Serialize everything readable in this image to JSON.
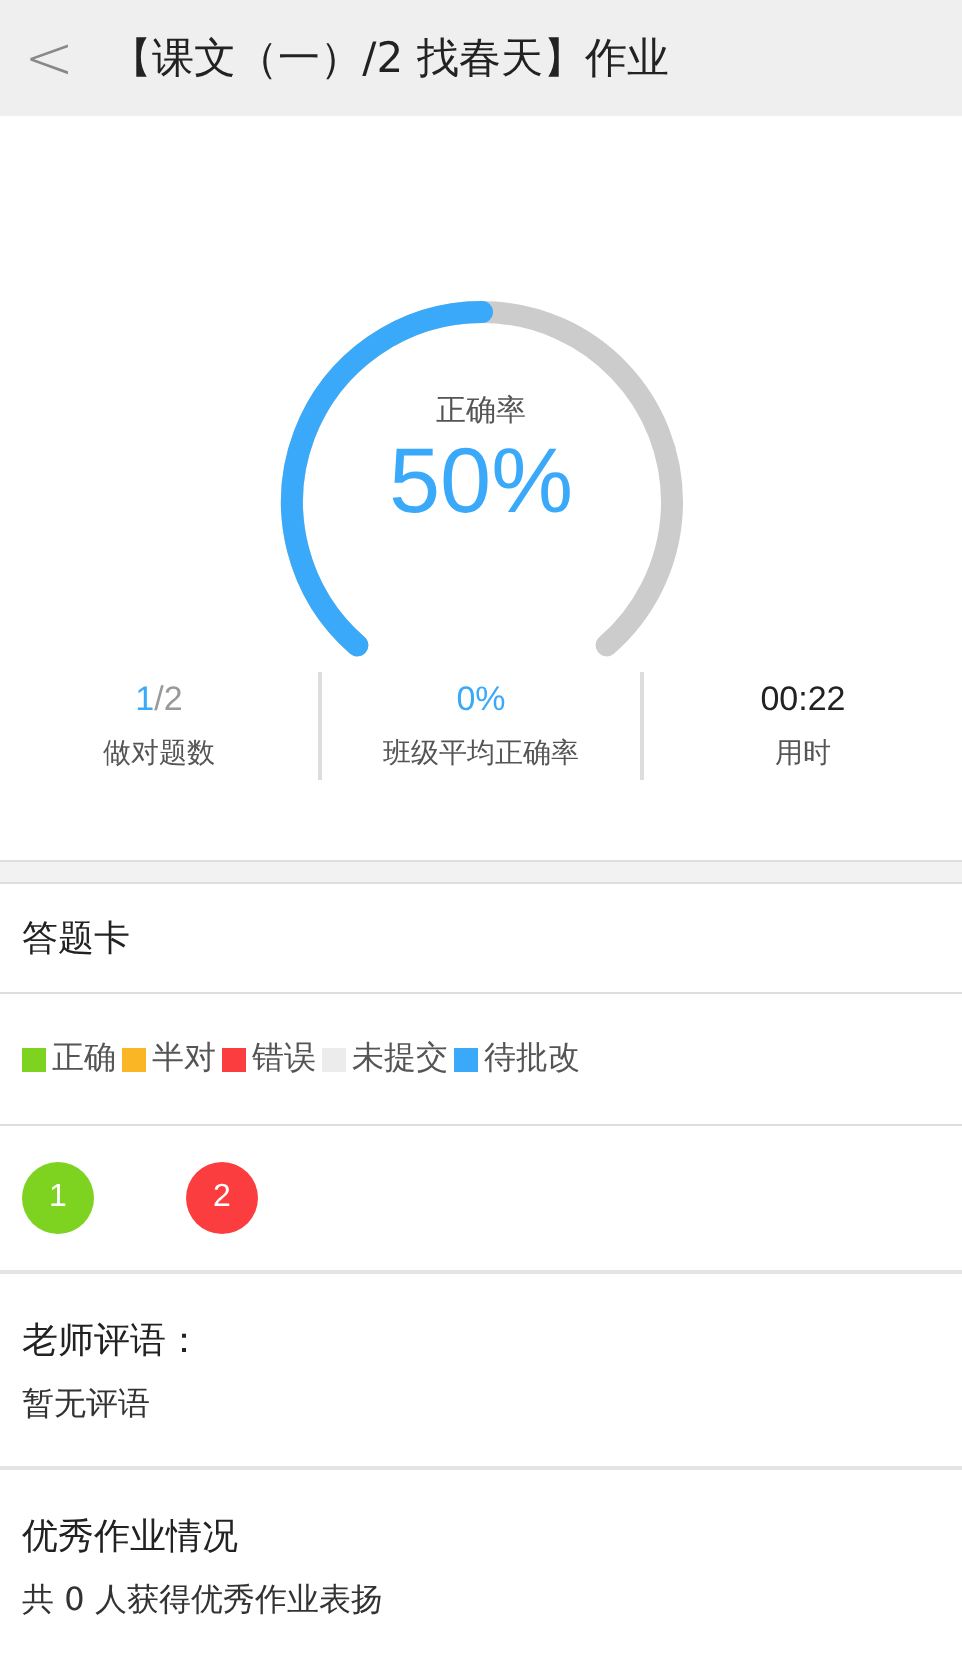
{
  "header": {
    "back_icon": "<",
    "title": "【课文（一）/2 找春天】作业"
  },
  "gauge": {
    "label": "正确率",
    "value": "50%",
    "level": 0.5
  },
  "stats": [
    {
      "value_parts": [
        {
          "text": "1",
          "accent": true
        },
        {
          "text": "/2",
          "accent": false
        }
      ],
      "label": "做对题数"
    },
    {
      "value_parts": [
        {
          "text": "0%",
          "accent": true
        }
      ],
      "label": "班级平均正确率"
    },
    {
      "value_parts": [
        {
          "text": "00:22",
          "accent": false
        }
      ],
      "label": "用时"
    }
  ],
  "answer_card": {
    "title": "答题卡",
    "legend": [
      {
        "label": "正确",
        "color": "#7ed321"
      },
      {
        "label": "半对",
        "color": "#fbb626"
      },
      {
        "label": "错误",
        "color": "#fc3d3f"
      },
      {
        "label": "未提交",
        "color": "#ececec"
      },
      {
        "label": "待批改",
        "color": "#3aa9fa"
      }
    ],
    "questions": [
      {
        "number": "1",
        "color": "#7ed321"
      },
      {
        "number": "2",
        "color": "#fc3d3f"
      }
    ]
  },
  "teacher_comment": {
    "title": "老师评语：",
    "text": "暂无评语"
  },
  "excellent": {
    "title": "优秀作业情况",
    "text": "共 0 人获得优秀作业表扬"
  }
}
